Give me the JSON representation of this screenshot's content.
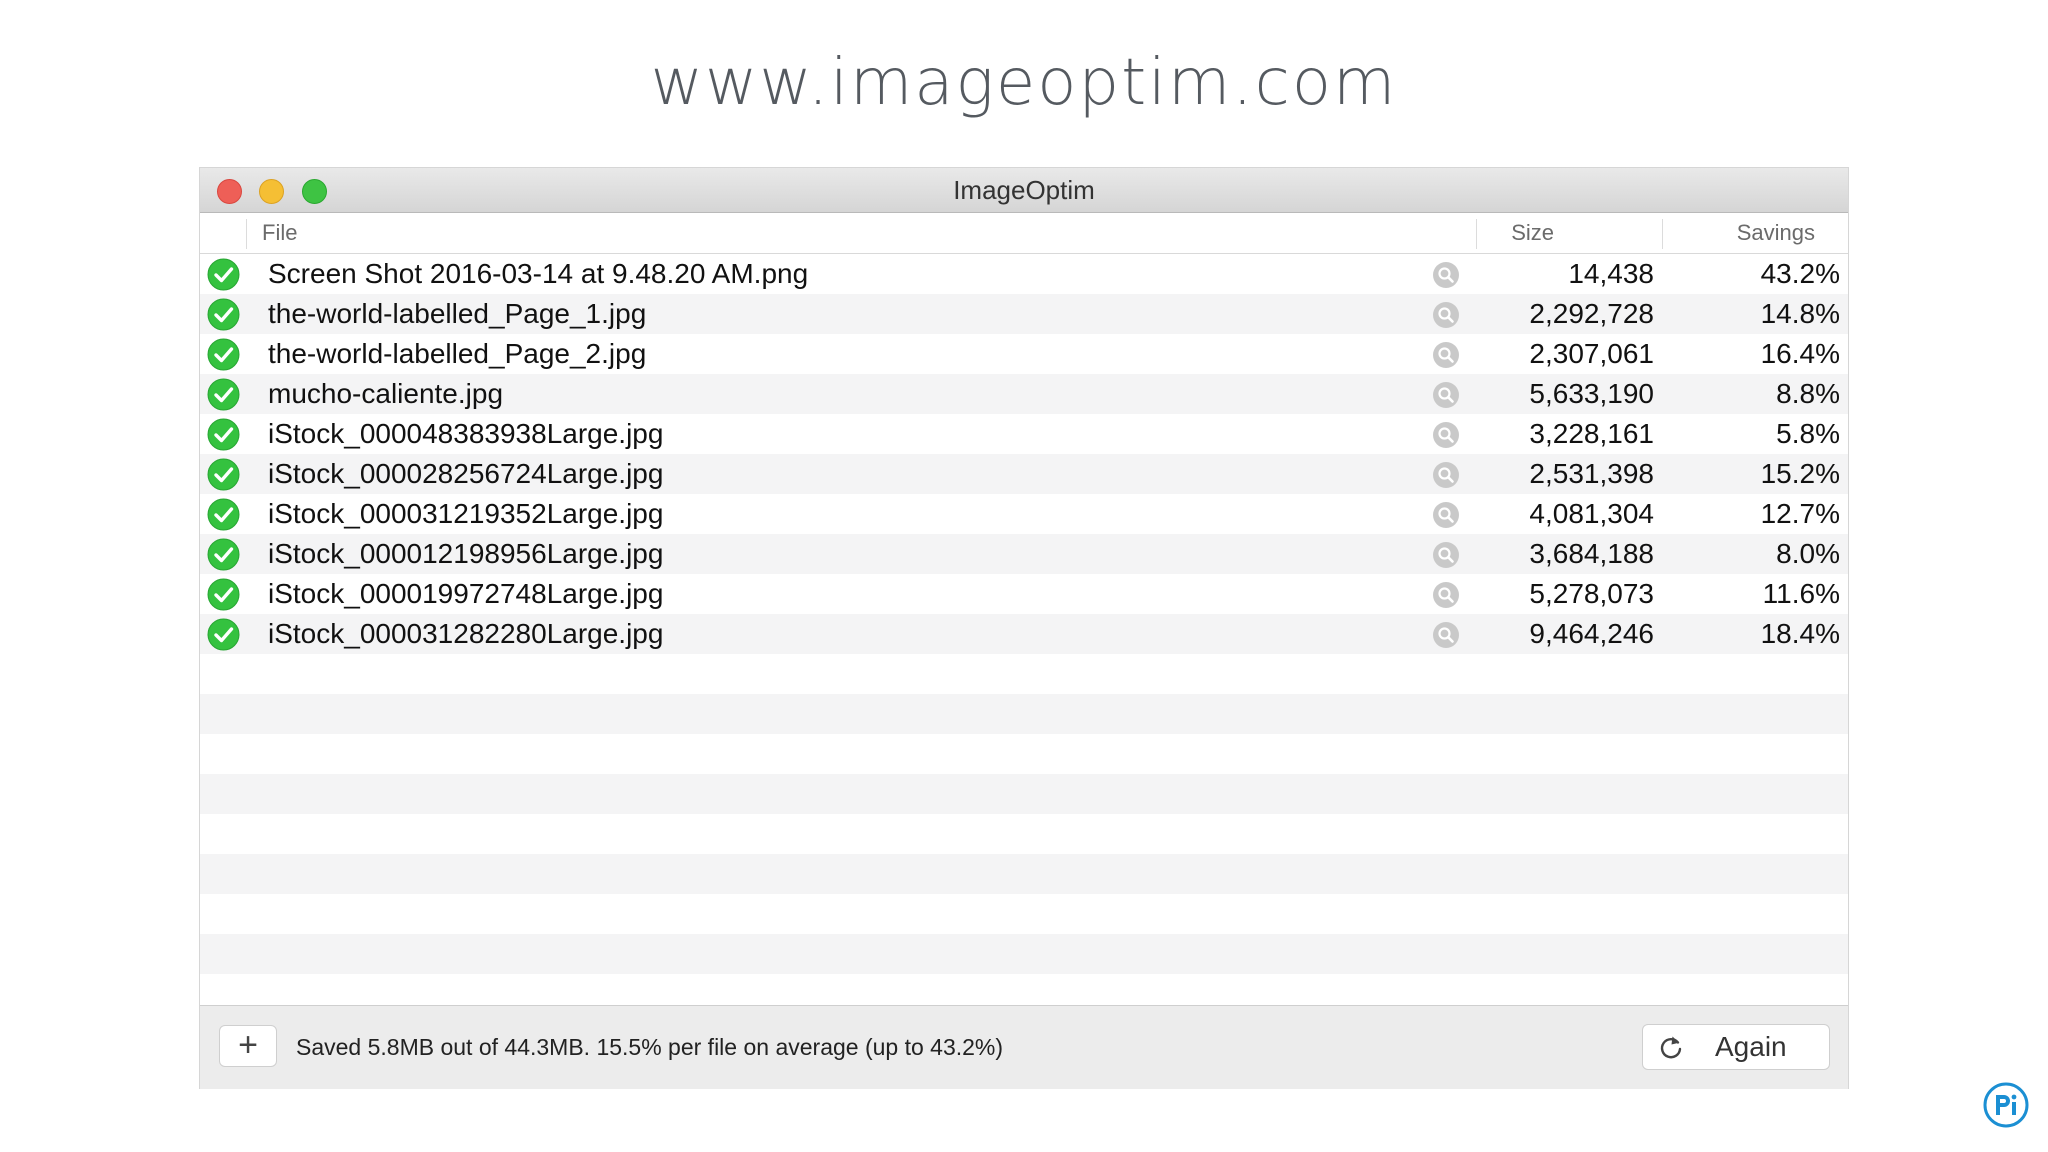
{
  "site": {
    "url": "www.imageoptim.com"
  },
  "window": {
    "title": "ImageOptim"
  },
  "columns": {
    "file": "File",
    "size": "Size",
    "savings": "Savings"
  },
  "files": [
    {
      "name": "Screen Shot 2016-03-14 at 9.48.20 AM.png",
      "size": "14,438",
      "savings": "43.2%"
    },
    {
      "name": "the-world-labelled_Page_1.jpg",
      "size": "2,292,728",
      "savings": "14.8%"
    },
    {
      "name": "the-world-labelled_Page_2.jpg",
      "size": "2,307,061",
      "savings": "16.4%"
    },
    {
      "name": "mucho-caliente.jpg",
      "size": "5,633,190",
      "savings": "8.8%"
    },
    {
      "name": "iStock_000048383938Large.jpg",
      "size": "3,228,161",
      "savings": "5.8%"
    },
    {
      "name": "iStock_000028256724Large.jpg",
      "size": "2,531,398",
      "savings": "15.2%"
    },
    {
      "name": "iStock_000031219352Large.jpg",
      "size": "4,081,304",
      "savings": "12.7%"
    },
    {
      "name": "iStock_000012198956Large.jpg",
      "size": "3,684,188",
      "savings": "8.0%"
    },
    {
      "name": "iStock_000019972748Large.jpg",
      "size": "5,278,073",
      "savings": "11.6%"
    },
    {
      "name": "iStock_000031282280Large.jpg",
      "size": "9,464,246",
      "savings": "18.4%"
    }
  ],
  "status": {
    "text": "Saved 5.8MB out of 44.3MB. 15.5% per file on average (up to 43.2%)",
    "add_symbol": "+",
    "again_label": "Again"
  },
  "icons": {
    "row_status": "checkmark-circle-icon",
    "row_action": "magnifier-icon",
    "again": "refresh-icon",
    "corner": "pi-logo"
  },
  "colors": {
    "check_green": "#34c23f",
    "close": "#ee5f57",
    "minimize": "#f5bf34",
    "zoom": "#3ec343",
    "corner_logo": "#1b8fd3"
  }
}
